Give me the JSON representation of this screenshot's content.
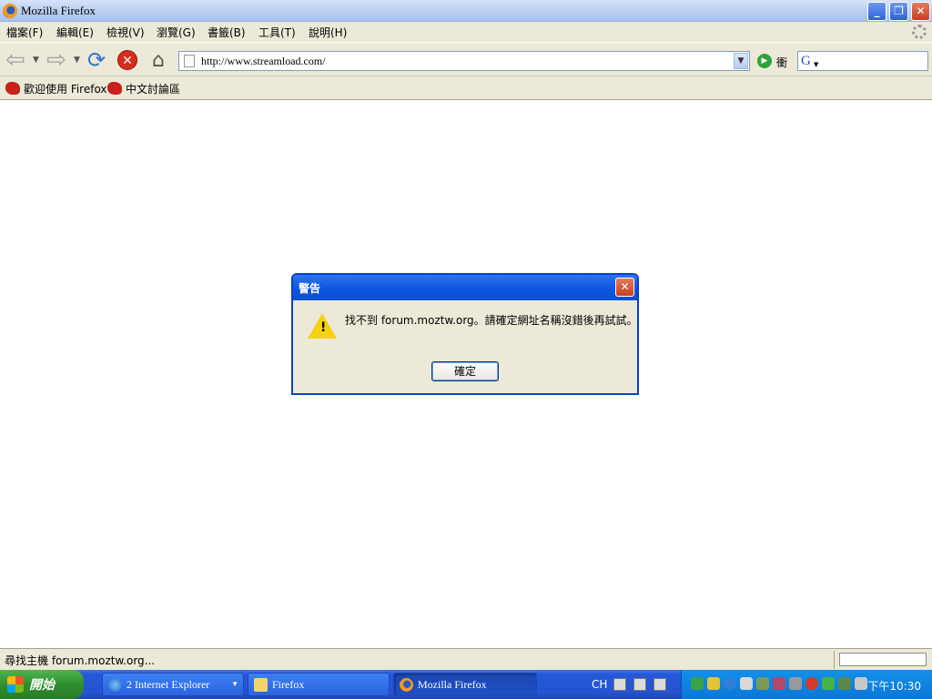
{
  "window": {
    "title": "Mozilla Firefox"
  },
  "menu": [
    {
      "label": "檔案(F)"
    },
    {
      "label": "編輯(E)"
    },
    {
      "label": "檢視(V)"
    },
    {
      "label": "瀏覽(G)"
    },
    {
      "label": "書籤(B)"
    },
    {
      "label": "工具(T)"
    },
    {
      "label": "說明(H)"
    }
  ],
  "navbar": {
    "url": "http://www.streamload.com/",
    "go_label": "衝",
    "search_engine_glyph": "G"
  },
  "bookmarks": [
    {
      "label": "歡迎使用 Firefox"
    },
    {
      "label": "中文討論區"
    }
  ],
  "dialog": {
    "title": "警告",
    "message": "找不到 forum.moztw.org。請確定網址名稱沒錯後再試試。",
    "ok_label": "確定"
  },
  "status": {
    "text": "尋找主機 forum.moztw.org..."
  },
  "taskbar": {
    "start_label": "開始",
    "tasks": [
      {
        "label": "2 Internet Explorer"
      },
      {
        "label": "Firefox"
      },
      {
        "label": "Mozilla Firefox"
      }
    ],
    "language": "CH",
    "clock": "下午10:30"
  },
  "icons": {
    "back": "back-arrow-icon",
    "forward": "forward-arrow-icon",
    "reload": "reload-icon",
    "stop": "stop-icon",
    "home": "home-icon",
    "warning": "warning-icon"
  },
  "colors": {
    "titlebar_blue": "#0a55e0",
    "dialog_bg": "#ece9d8",
    "warning_yellow": "#f5d312",
    "stop_red": "#d72d1c"
  }
}
